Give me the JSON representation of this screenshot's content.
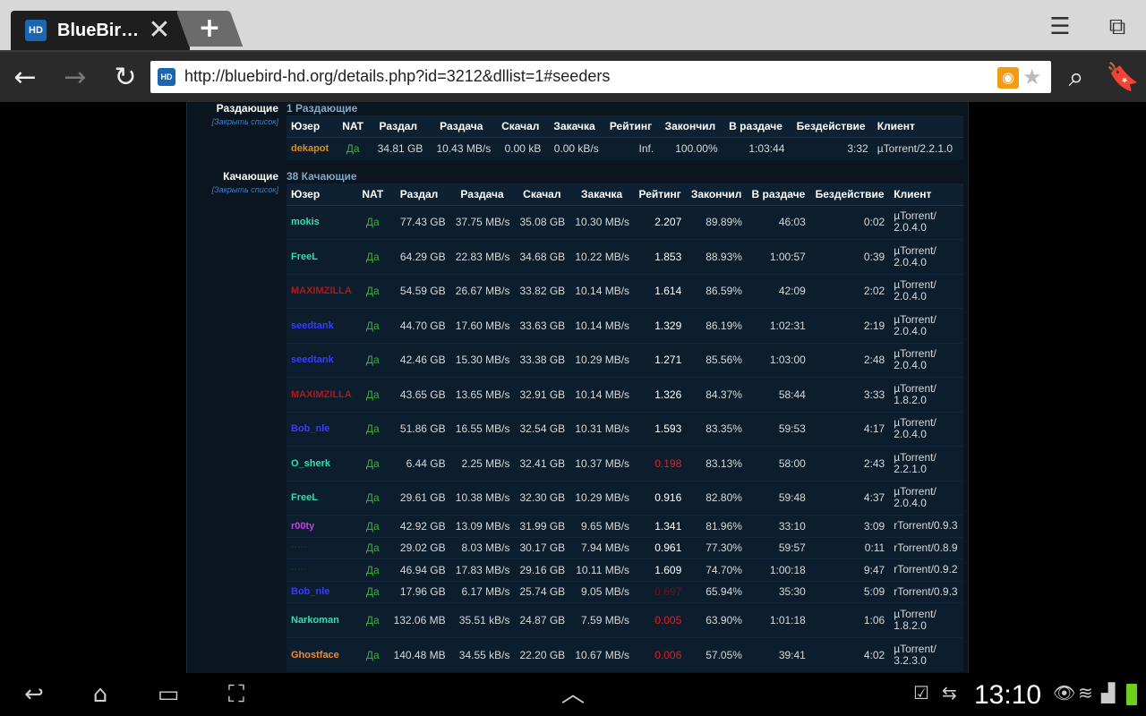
{
  "browser": {
    "tab_title": "BlueBir…",
    "favicon_text": "HD",
    "new_tab_label": "+",
    "url": "http://bluebird-hd.org/details.php?id=3212&dllist=1#seeders"
  },
  "seeders": {
    "label": "Раздающие",
    "close_link": "[Закрыть список]",
    "count": "1 Раздающие",
    "headers": [
      "Юзер",
      "NAT",
      "Раздал",
      "Раздача",
      "Скачал",
      "Закачка",
      "Рейтинг",
      "Закончил",
      "В раздаче",
      "Бездействие",
      "Клиент"
    ],
    "rows": [
      {
        "user": "dekapot",
        "color": "#e08a1e",
        "nat": "Да",
        "uploaded": "34.81 GB",
        "up_speed": "10.43 MB/s",
        "downloaded": "0.00 kB",
        "down_speed": "0.00 kB/s",
        "rating": "Inf.",
        "rating_color": "#d8d8d8",
        "done": "100.00%",
        "seeding": "1:03:44",
        "idle": "3:32",
        "client": "µTorrent/2.2.1.0"
      }
    ]
  },
  "leechers": {
    "label": "Качающие",
    "close_link": "[Закрыть список]",
    "count": "38 Качающие",
    "headers": [
      "Юзер",
      "NAT",
      "Раздал",
      "Раздача",
      "Скачал",
      "Закачка",
      "Рейтинг",
      "Закончил",
      "В раздаче",
      "Бездействие",
      "Клиент"
    ],
    "rows": [
      {
        "user": "mokis",
        "color": "#2fe0b0",
        "nat": "Да",
        "uploaded": "77.43 GB",
        "up_speed": "37.75 MB/s",
        "downloaded": "35.08 GB",
        "down_speed": "10.30 MB/s",
        "rating": "2.207",
        "rating_color": "#ffffff",
        "done": "89.89%",
        "seeding": "46:03",
        "idle": "0:02",
        "client": "µTorrent/ 2.0.4.0"
      },
      {
        "user": "FreeL",
        "color": "#2fe0b0",
        "nat": "Да",
        "uploaded": "64.29 GB",
        "up_speed": "22.83 MB/s",
        "downloaded": "34.68 GB",
        "down_speed": "10.22 MB/s",
        "rating": "1.853",
        "rating_color": "#ffffff",
        "done": "88.93%",
        "seeding": "1:00:57",
        "idle": "0:39",
        "client": "µTorrent/ 2.0.4.0"
      },
      {
        "user": "MAXIMZILLA",
        "color": "#b01818",
        "nat": "Да",
        "uploaded": "54.59 GB",
        "up_speed": "26.67 MB/s",
        "downloaded": "33.82 GB",
        "down_speed": "10.14 MB/s",
        "rating": "1.614",
        "rating_color": "#ffffff",
        "done": "86.59%",
        "seeding": "42:09",
        "idle": "2:02",
        "client": "µTorrent/ 2.0.4.0"
      },
      {
        "user": "seedtank",
        "color": "#3a3aff",
        "nat": "Да",
        "uploaded": "44.70 GB",
        "up_speed": "17.60 MB/s",
        "downloaded": "33.63 GB",
        "down_speed": "10.14 MB/s",
        "rating": "1.329",
        "rating_color": "#ffffff",
        "done": "86.19%",
        "seeding": "1:02:31",
        "idle": "2:19",
        "client": "µTorrent/ 2.0.4.0"
      },
      {
        "user": "seedtank",
        "color": "#3a3aff",
        "nat": "Да",
        "uploaded": "42.46 GB",
        "up_speed": "15.30 MB/s",
        "downloaded": "33.38 GB",
        "down_speed": "10.29 MB/s",
        "rating": "1.271",
        "rating_color": "#ffffff",
        "done": "85.56%",
        "seeding": "1:03:00",
        "idle": "2:48",
        "client": "µTorrent/ 2.0.4.0"
      },
      {
        "user": "MAXIMZILLA",
        "color": "#b01818",
        "nat": "Да",
        "uploaded": "43.65 GB",
        "up_speed": "13.65 MB/s",
        "downloaded": "32.91 GB",
        "down_speed": "10.14 MB/s",
        "rating": "1.326",
        "rating_color": "#ffffff",
        "done": "84.37%",
        "seeding": "58:44",
        "idle": "3:33",
        "client": "µTorrent/ 1.8.2.0"
      },
      {
        "user": "Bob_nle",
        "color": "#3a3aff",
        "nat": "Да",
        "uploaded": "51.86 GB",
        "up_speed": "16.55 MB/s",
        "downloaded": "32.54 GB",
        "down_speed": "10.31 MB/s",
        "rating": "1.593",
        "rating_color": "#ffffff",
        "done": "83.35%",
        "seeding": "59:53",
        "idle": "4:17",
        "client": "µTorrent/ 2.0.4.0"
      },
      {
        "user": "O_sherk",
        "color": "#2fe0b0",
        "nat": "Да",
        "uploaded": "6.44 GB",
        "up_speed": "2.25 MB/s",
        "downloaded": "32.41 GB",
        "down_speed": "10.37 MB/s",
        "rating": "0.198",
        "rating_color": "#e02020",
        "done": "83.13%",
        "seeding": "58:00",
        "idle": "2:43",
        "client": "µTorrent/ 2.2.1.0"
      },
      {
        "user": "FreeL",
        "color": "#2fe0b0",
        "nat": "Да",
        "uploaded": "29.61 GB",
        "up_speed": "10.38 MB/s",
        "downloaded": "32.30 GB",
        "down_speed": "10.29 MB/s",
        "rating": "0.916",
        "rating_color": "#ffffff",
        "done": "82.80%",
        "seeding": "59:48",
        "idle": "4:37",
        "client": "µTorrent/ 2.0.4.0"
      },
      {
        "user": "r00ty",
        "color": "#c040e0",
        "nat": "Да",
        "uploaded": "42.92 GB",
        "up_speed": "13.09 MB/s",
        "downloaded": "31.99 GB",
        "down_speed": "9.65 MB/s",
        "rating": "1.341",
        "rating_color": "#ffffff",
        "done": "81.96%",
        "seeding": "33:10",
        "idle": "3:09",
        "client": "rTorrent/0.9.3"
      },
      {
        "user": "·····",
        "color": "#0f3a26",
        "nat": "Да",
        "uploaded": "29.02 GB",
        "up_speed": "8.03 MB/s",
        "downloaded": "30.17 GB",
        "down_speed": "7.94 MB/s",
        "rating": "0.961",
        "rating_color": "#ffffff",
        "done": "77.30%",
        "seeding": "59:57",
        "idle": "0:11",
        "client": "rTorrent/0.8.9"
      },
      {
        "user": "·····",
        "color": "#0f3a26",
        "nat": "Да",
        "uploaded": "46.94 GB",
        "up_speed": "17.83 MB/s",
        "downloaded": "29.16 GB",
        "down_speed": "10.11 MB/s",
        "rating": "1.609",
        "rating_color": "#ffffff",
        "done": "74.70%",
        "seeding": "1:00:18",
        "idle": "9:47",
        "client": "rTorrent/0.9.2"
      },
      {
        "user": "Bob_nle",
        "color": "#3a3aff",
        "nat": "Да",
        "uploaded": "17.96 GB",
        "up_speed": "6.17 MB/s",
        "downloaded": "25.74 GB",
        "down_speed": "9.05 MB/s",
        "rating": "0.697",
        "rating_color": "#6a1414",
        "done": "65.94%",
        "seeding": "35:30",
        "idle": "5:09",
        "client": "rTorrent/0.9.3"
      },
      {
        "user": "Narkoman",
        "color": "#2fe0b0",
        "nat": "Да",
        "uploaded": "132.06 MB",
        "up_speed": "35.51 kB/s",
        "downloaded": "24.87 GB",
        "down_speed": "7.59 MB/s",
        "rating": "0.005",
        "rating_color": "#e02020",
        "done": "63.90%",
        "seeding": "1:01:18",
        "idle": "1:06",
        "client": "µTorrent/ 1.8.2.0"
      },
      {
        "user": "Ghostface",
        "color": "#f08a3a",
        "nat": "Да",
        "uploaded": "140.48 MB",
        "up_speed": "34.55 kB/s",
        "downloaded": "22.20 GB",
        "down_speed": "10.67 MB/s",
        "rating": "0.006",
        "rating_color": "#e02020",
        "done": "57.05%",
        "seeding": "39:41",
        "idle": "4:02",
        "client": "µTorrent/ 3.2.3.0"
      }
    ]
  },
  "status_bar": {
    "time": "13:10"
  }
}
